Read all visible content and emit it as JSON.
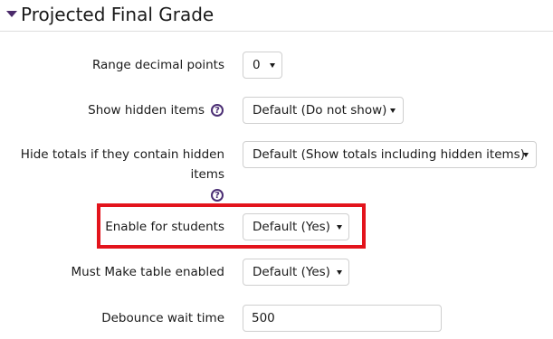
{
  "section": {
    "title": "Projected Final Grade"
  },
  "fields": {
    "range_decimal_points": {
      "label": "Range decimal points",
      "value": "0"
    },
    "show_hidden_items": {
      "label": "Show hidden items",
      "value": "Default (Do not show)"
    },
    "hide_totals": {
      "label": "Hide totals if they contain hidden items",
      "value": "Default (Show totals including hidden items)"
    },
    "enable_for_students": {
      "label": "Enable for students",
      "value": "Default (Yes)"
    },
    "must_make_table": {
      "label": "Must Make table enabled",
      "value": "Default (Yes)"
    },
    "debounce_wait_time": {
      "label": "Debounce wait time",
      "value": "500"
    }
  },
  "icons": {
    "help": "?",
    "collapse": "triangle-down-icon",
    "dropdown": "caret-down-icon"
  },
  "colors": {
    "highlight": "#e3141c",
    "help_icon": "#4b2e74",
    "collapse_icon": "#4a2a6a"
  }
}
